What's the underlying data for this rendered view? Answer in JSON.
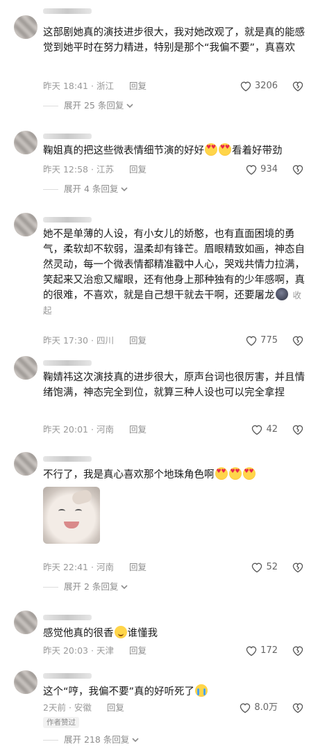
{
  "comments": [
    {
      "text": "这部剧她真的演技进步很大，我对她改观了，就是真的能感觉到她平时在努力精进，特别是那个“我偏不要”，真喜欢",
      "time": "昨天 18:41",
      "location": "浙江",
      "reply": "回复",
      "likes": "3206",
      "expand": "展开 25 条回复"
    },
    {
      "text": "鞠姐真的把这些微表情细节演的好好",
      "text_after": "看着好带劲",
      "time": "昨天 12:58",
      "location": "江苏",
      "reply": "回复",
      "likes": "934",
      "expand": "展开 4 条回复"
    },
    {
      "text": "她不是单薄的人设，有小女儿的娇憨，也有直面困境的勇气，柔软却不软弱，温柔却有锋芒。眉眼精致如画，神态自然灵动，每一个微表情都精准戳中人心，哭戏共情力拉满，笑起来又治愈又耀眼，还有他身上那种独有的少年感啊，真的很难，不喜欢，就是自己想干就去干啊，还要屠龙",
      "collapse": "收起",
      "time": "昨天 17:30",
      "location": "四川",
      "reply": "回复",
      "likes": "775"
    },
    {
      "text": "鞠婧祎这次演技真的进步很大，原声台词也很厉害，并且情绪饱满，神态完全到位，就算三种人设也可以完全拿捏",
      "time": "昨天 20:01",
      "location": "河南",
      "reply": "回复",
      "likes": "42"
    },
    {
      "text": "不行了，我是真心喜欢那个地珠角色啊",
      "time": "昨天 22:41",
      "location": "河南",
      "reply": "回复",
      "likes": "52",
      "expand": "展开 2 条回复"
    },
    {
      "text": "感觉他真的很香",
      "text_after": "谁懂我",
      "time": "昨天 20:03",
      "location": "天津",
      "reply": "回复",
      "likes": "172"
    },
    {
      "text": "这个“哼，我偏不要”真的好听死了",
      "time": "2天前",
      "location": "安徽",
      "reply": "回复",
      "likes": "8.0万",
      "badge": "作者赞过",
      "expand": "展开 218 条回复"
    }
  ],
  "icons": {
    "like": "heart-outline-icon",
    "dislike": "broken-heart-icon",
    "expand": "chevron-down-icon",
    "emoji_heart_eyes": "heart-eyes-emoji",
    "emoji_dark": "dark-moon-emoji",
    "emoji_smile": "smiling-emoji",
    "emoji_cry": "crying-emoji"
  },
  "colors": {
    "text": "#1a1a1a",
    "meta": "#999999",
    "link": "#8c8c8c"
  }
}
